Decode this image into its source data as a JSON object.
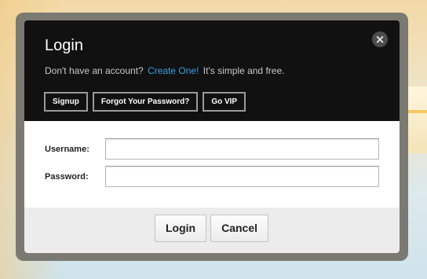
{
  "dialog": {
    "title": "Login",
    "close_icon": "close-icon",
    "subtitle": {
      "prefix": "Don't have an account?",
      "link": "Create One!",
      "suffix": "It's simple and free."
    },
    "top_buttons": [
      {
        "label": "Signup"
      },
      {
        "label": "Forgot Your Password?"
      },
      {
        "label": "Go VIP"
      }
    ],
    "form": {
      "username_label": "Username:",
      "username_value": "",
      "password_label": "Password:",
      "password_value": ""
    },
    "footer_buttons": {
      "login_label": "Login",
      "cancel_label": "Cancel"
    }
  },
  "colors": {
    "dialog_bg": "#111111",
    "link": "#3c9fe0",
    "frame": "#7a7a72"
  }
}
